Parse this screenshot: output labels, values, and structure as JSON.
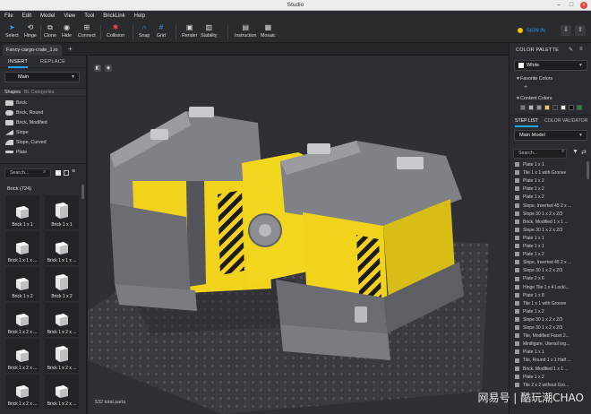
{
  "window": {
    "title": "Studio"
  },
  "menu": [
    "File",
    "Edit",
    "Model",
    "View",
    "Tool",
    "BrickLink",
    "Help"
  ],
  "toolbar": {
    "tools": [
      {
        "label": "Select",
        "icon": "cursor-icon"
      },
      {
        "label": "Hinge",
        "icon": "hinge-icon"
      },
      {
        "label": "Clone",
        "icon": "clone-icon"
      },
      {
        "label": "Hide",
        "icon": "eye-icon"
      },
      {
        "label": "Connect",
        "icon": "connect-icon"
      },
      {
        "label": "Collision",
        "icon": "collision-icon"
      },
      {
        "label": "Snap",
        "icon": "magnet-icon"
      },
      {
        "label": "Grid",
        "icon": "grid-icon"
      },
      {
        "label": "Render",
        "icon": "render-icon"
      },
      {
        "label": "Stability",
        "icon": "stability-icon"
      },
      {
        "label": "Instruction",
        "icon": "instruction-icon"
      },
      {
        "label": "Mosaic",
        "icon": "mosaic-icon"
      }
    ],
    "signin": "SIGN IN"
  },
  "file_tab": "Fancy-cargo-crate_1.io",
  "left_panel": {
    "tabs": [
      "INSERT",
      "REPLACE"
    ],
    "palette_select": "Main",
    "section_shapes": "Shapes",
    "section_categories": "BL Categories",
    "shapes": [
      "Brick",
      "Brick, Round",
      "Brick, Modified",
      "Slope",
      "Slope, Curved",
      "Plate"
    ],
    "search_placeholder": "Search...",
    "brick_header": "Brick (724)",
    "bricks": [
      "Brick 1 x 1",
      "Brick 1 x 1",
      "Brick 1 x 1 x ...",
      "Brick 1 x 1 x ...",
      "Brick 1 x 2",
      "Brick 1 x 2",
      "Brick 1 x 2 x ...",
      "Brick 1 x 2 x ...",
      "Brick 1 x 2 x ...",
      "Brick 1 x 2 x ...",
      "Brick 1 x 2 x ...",
      "Brick 1 x 2 x ..."
    ]
  },
  "viewport": {
    "parts_count": "532 total parts"
  },
  "right_panel": {
    "color_palette_title": "COLOR PALETTE",
    "selected_color": "White",
    "favorite_colors": "Favorite Colors",
    "content_colors": "Content Colors",
    "content_swatches": [
      "#7a7c80",
      "#b9b9b9",
      "#9a9aa0",
      "#f4d24a",
      "#2b2c31",
      "#ffffff",
      "#111111",
      "#1e8a37"
    ],
    "tabs": [
      "STEP LIST",
      "COLOR VALIDATOR"
    ],
    "model_select": "Main Model",
    "search_placeholder": "Search...",
    "steps": [
      "Plate 1 x 1",
      "Tile 1 x 1 with Groove",
      "Plate 1 x 2",
      "Plate 1 x 2",
      "Plate 1 x 2",
      "Slope, Inverted 45 2 x ...",
      "Slope 30 1 x 2 x 2/3",
      "Brick, Modified 1 x 1 ...",
      "Slope 30 1 x 2 x 2/3",
      "Plate 1 x 1",
      "Plate 1 x 1",
      "Plate 1 x 2",
      "Slope, Inverted 45 2 x ...",
      "Slope 30 1 x 2 x 2/3",
      "Plate 2 x 6",
      "Hinge Tile 1 x 4 Locki...",
      "Plate 1 x 8",
      "Tile 1 x 1 with Groove",
      "Plate 1 x 2",
      "Slope 30 1 x 2 x 2/3",
      "Slope 30 1 x 2 x 2/3",
      "Tile, Modified Facet 2...",
      "Minifigure, Utensil Ing...",
      "Plate 1 x 1",
      "Tile, Round 1 x 1 Half ...",
      "Brick, Modified 1 x 1 ...",
      "Plate 1 x 2",
      "Tile 2 x 2 without Gro..."
    ]
  },
  "watermark": "网易号 | 酷玩潮CHAO"
}
